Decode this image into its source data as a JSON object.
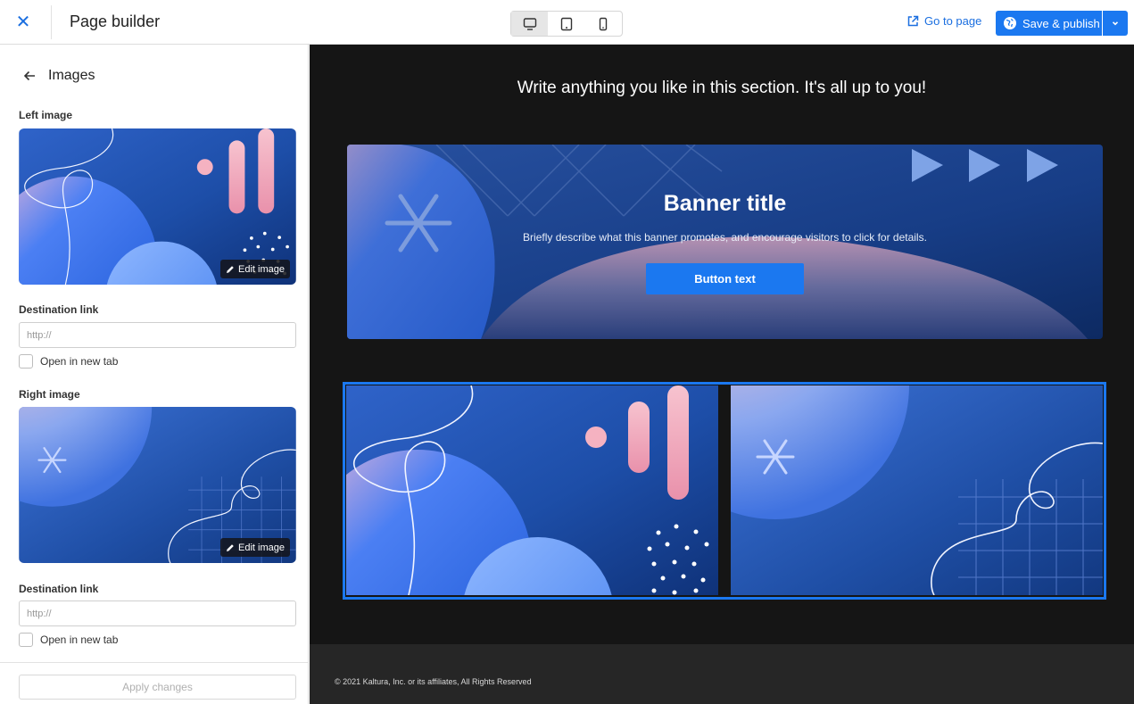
{
  "header": {
    "close_icon": "close-icon",
    "title": "Page builder",
    "devices": [
      {
        "name": "desktop",
        "icon": "desktop-icon",
        "active": true
      },
      {
        "name": "tablet",
        "icon": "tablet-icon",
        "active": false
      },
      {
        "name": "mobile",
        "icon": "mobile-icon",
        "active": false
      }
    ],
    "go_to_page": "Go to page",
    "save_publish": "Save & publish",
    "accent_color": "#1b78f0"
  },
  "sidebar": {
    "back_label": "Images",
    "left_image": {
      "label": "Left image",
      "edit_label": "Edit image",
      "destination_label": "Destination link",
      "destination_placeholder": "http://",
      "new_tab_label": "Open in new tab"
    },
    "right_image": {
      "label": "Right image",
      "edit_label": "Edit image",
      "destination_label": "Destination link",
      "destination_placeholder": "http://",
      "new_tab_label": "Open in new tab"
    },
    "apply_label": "Apply changes"
  },
  "canvas": {
    "heading": "Write anything you like in this section. It's all up to you!",
    "banner": {
      "title": "Banner title",
      "description": "Briefly describe what this banner promotes, and encourage visitors to click for details.",
      "button": "Button text"
    },
    "footer": "© 2021 Kaltura, Inc. or its affiliates, All Rights Reserved"
  }
}
